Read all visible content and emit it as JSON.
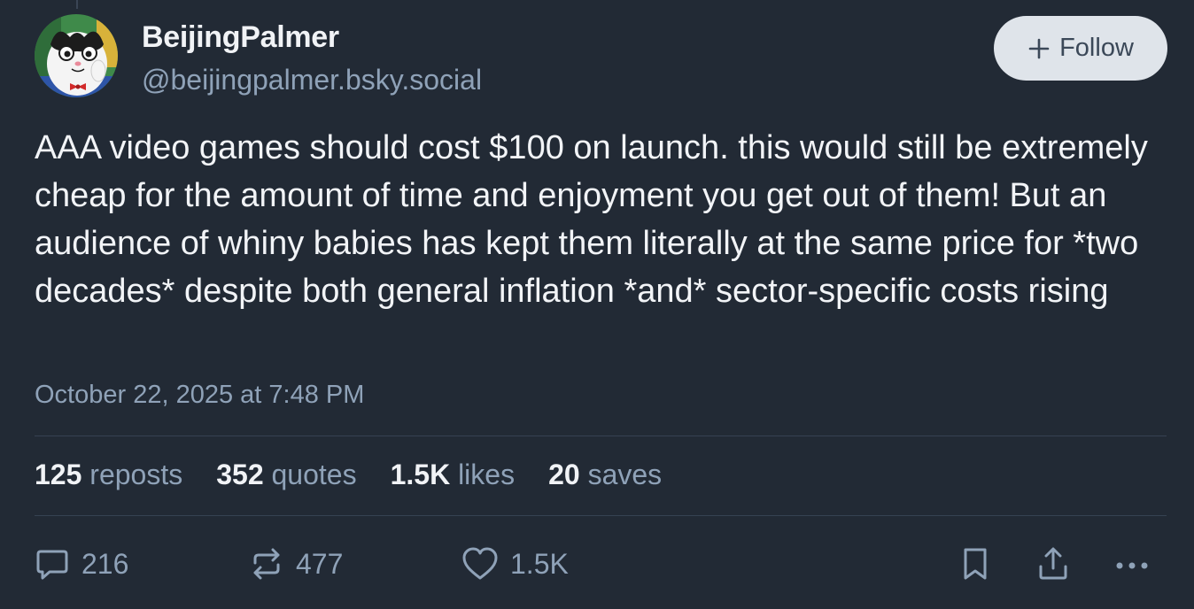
{
  "author": {
    "display_name": "BeijingPalmer",
    "handle": "@beijingpalmer.bsky.social"
  },
  "follow": {
    "label": "Follow",
    "icon": "plus-icon"
  },
  "post": {
    "text": "AAA video games should cost $100 on launch. this would still be extremely cheap for the amount of time and enjoyment you get out of them! But an audience of whiny babies has kept them literally at the same price for *two decades* despite both general inflation *and* sector-specific costs rising",
    "timestamp": "October 22, 2025 at 7:48 PM"
  },
  "stats": {
    "reposts": {
      "count": "125",
      "label": "reposts"
    },
    "quotes": {
      "count": "352",
      "label": "quotes"
    },
    "likes": {
      "count": "1.5K",
      "label": "likes"
    },
    "saves": {
      "count": "20",
      "label": "saves"
    }
  },
  "actions": {
    "reply": {
      "icon": "reply-icon",
      "count": "216"
    },
    "repost": {
      "icon": "repost-icon",
      "count": "477"
    },
    "like": {
      "icon": "heart-icon",
      "count": "1.5K"
    },
    "bookmark": {
      "icon": "bookmark-icon"
    },
    "share": {
      "icon": "share-icon"
    },
    "more": {
      "icon": "more-icon"
    }
  },
  "colors": {
    "background": "#222a35",
    "text_primary": "#f1f3f6",
    "text_secondary": "#8fa2b8",
    "follow_bg": "#dfe4ea",
    "follow_text": "#3b4858",
    "divider": "#364252"
  }
}
